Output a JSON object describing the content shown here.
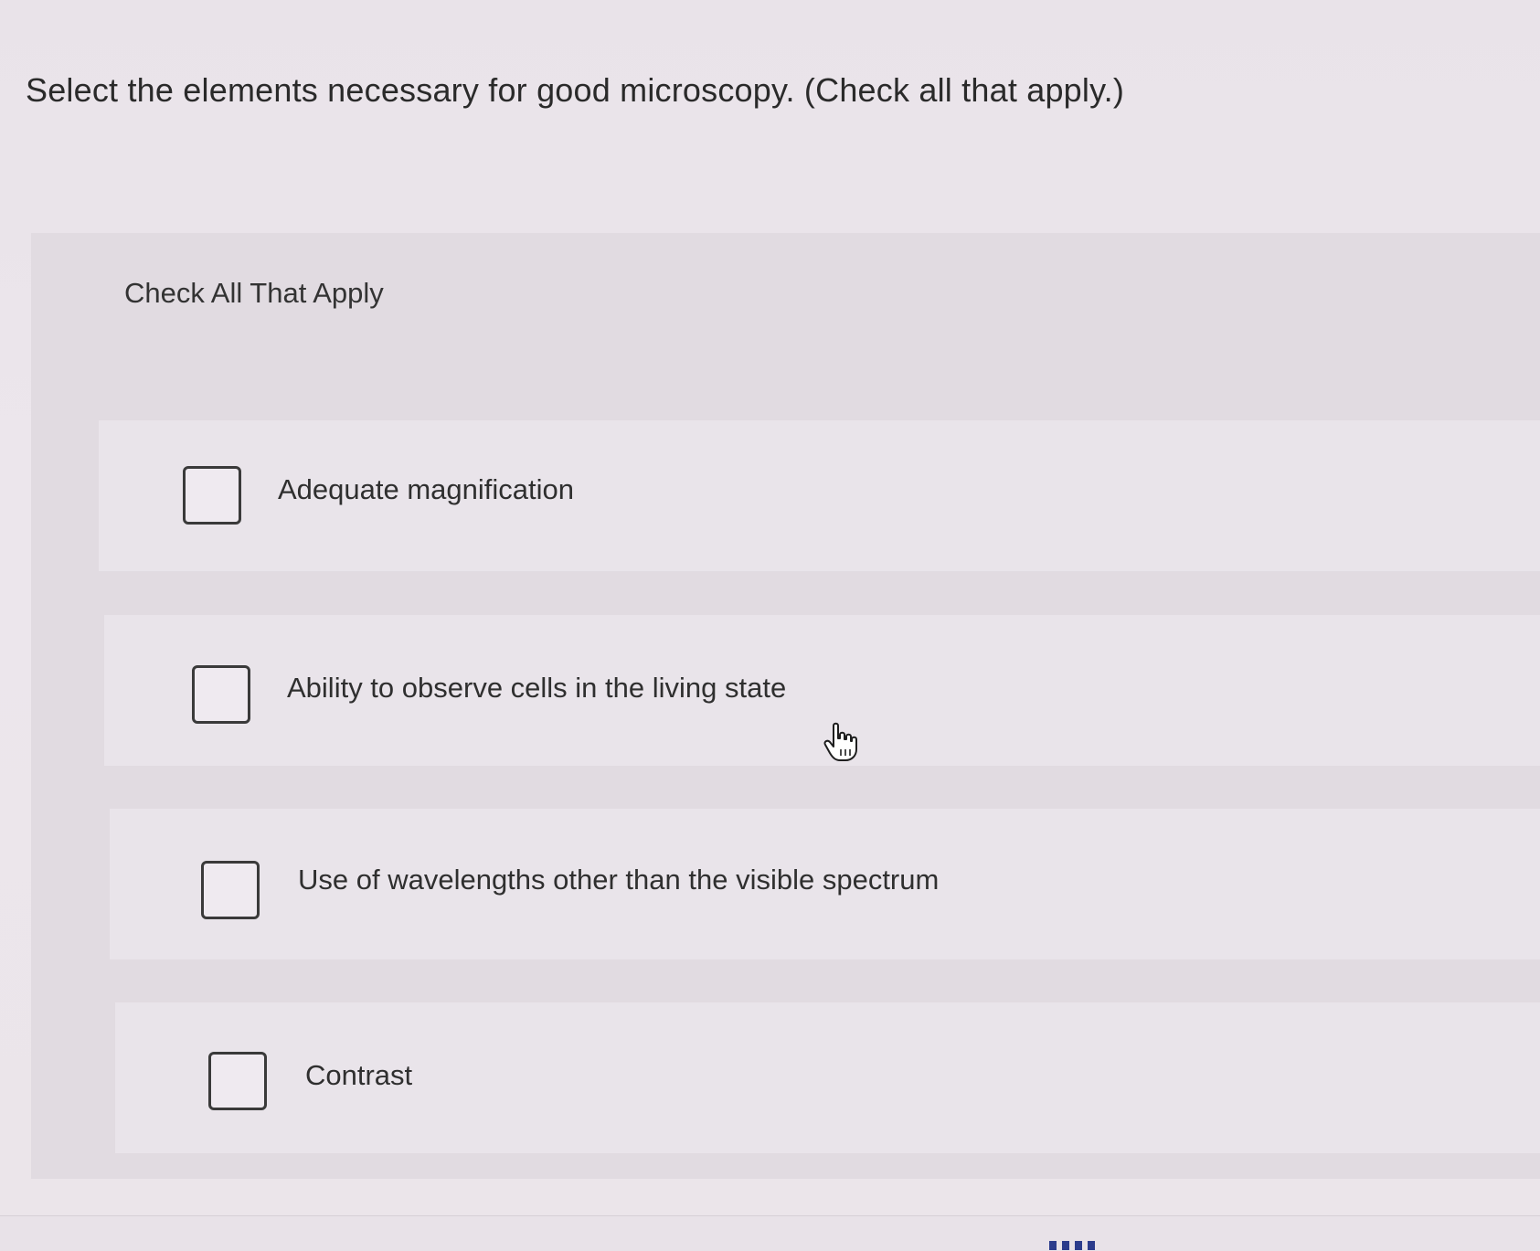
{
  "question": {
    "text": "Select the elements necessary for good microscopy. (Check all that apply.)"
  },
  "panel": {
    "header": "Check All That Apply",
    "options": [
      {
        "label": "Adequate magnification",
        "checked": false
      },
      {
        "label": "Ability to observe cells in the living state",
        "checked": false
      },
      {
        "label": "Use of wavelengths other than the visible spectrum",
        "checked": false
      },
      {
        "label": "Contrast",
        "checked": false
      }
    ]
  },
  "cursor": {
    "icon": "hand-pointer-icon"
  },
  "colors": {
    "page_bg": "#ebe5ea",
    "panel_bg": "#e1dbe1",
    "option_bg": "#e9e4ea",
    "checkbox_border": "#3a3a3a"
  }
}
